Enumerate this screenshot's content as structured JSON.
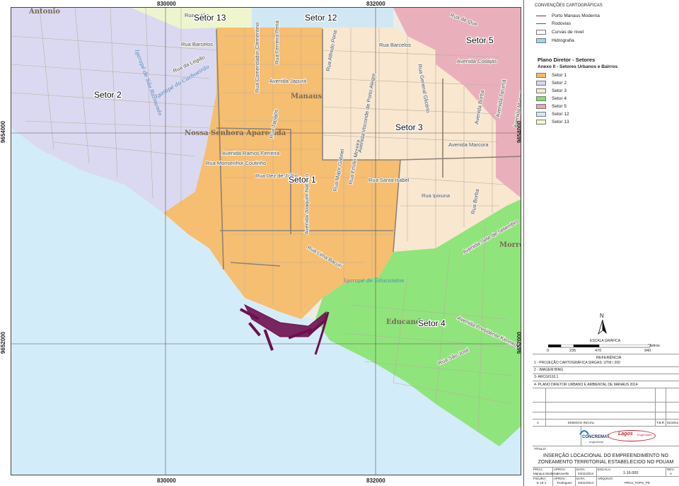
{
  "coordinates": {
    "top": [
      "830000",
      "832000"
    ],
    "bottom": [
      "830000",
      "832000"
    ],
    "left": [
      "9654000",
      "9652000"
    ],
    "right": [
      "9654000",
      "9652000"
    ]
  },
  "map": {
    "sectors": [
      {
        "label": "Setor 1",
        "color": "#f6b964"
      },
      {
        "label": "Setor 2",
        "color": "#d7d6f3"
      },
      {
        "label": "Setor 3",
        "color": "#f9e7cf"
      },
      {
        "label": "Setor 4",
        "color": "#7fe36a"
      },
      {
        "label": "Setor 5",
        "color": "#e8a6b4"
      },
      {
        "label": "Setor 12",
        "color": "#cfe8f4"
      },
      {
        "label": "Setor 13",
        "color": "#eef7cb"
      }
    ],
    "streets": [
      "Rua Avião",
      "Rua Barcelos",
      "Rua da Legião",
      "Rua Comendador Clementino",
      "Rua Ferreira Pena",
      "Avenida Japurá",
      "Rua Alfredo Pena",
      "Rua Tapajós",
      "Avenida Ramos Ferreira",
      "Rua Monsenhor Coutinho",
      "Rua Dez de Julho",
      "Rua Marechal Deodoro",
      "Avenida Joaquim Nabuco",
      "Rua Major Gabriel",
      "Rua Emílio Moreira",
      "Rua Santa Isabel",
      "Avenida Visconde de Porto Alegre",
      "Rua Lima Bacuri",
      "Rua Barcelos",
      "Avenida Codajás",
      "Rua General Glicério",
      "Avenida Marcora",
      "Avenida Borba",
      "Avenida Tarumã",
      "Avenida Manaus",
      "Rua Ipixuna",
      "Rua Borba",
      "Avenida Presidente Kennedy",
      "Rua Ceará",
      "Rua São José",
      "Avenida Sete de Setembro",
      "Rua Dr. Tapajós",
      "Rua de Que"
    ],
    "places": [
      "Antonio",
      "Nossa Senhora Aparecida",
      "Manaus",
      "Morro da Liberdade",
      "Educandos"
    ],
    "hydro": [
      "Igarapé de São Raimundo",
      "Igarapé do Cachoeirão",
      "Igarapé de Educandos"
    ],
    "port_color": "#6e0f4f"
  },
  "legend": {
    "heading": "CONVENÇÕES CARTOGRÁFICAS",
    "items": [
      {
        "label": "Porto Manaus Moderna",
        "kind": "line",
        "color": "#8e1f5b"
      },
      {
        "label": "Rodovias",
        "kind": "line",
        "color": "#555555"
      },
      {
        "label": "Curvas de nível",
        "kind": "box",
        "color": "#ffffff"
      },
      {
        "label": "Hidrografia",
        "kind": "box",
        "color": "#9fd4ef"
      }
    ],
    "plan_title": "Plano Diretor - Setores",
    "plan_subtitle": "Anexo II - Setores Urbanos e Bairros",
    "sector_items": [
      "Setor 1",
      "Setor 2",
      "Setor 3",
      "Setor 4",
      "Setor 5",
      "Setor 12",
      "Setor 13"
    ]
  },
  "north": {
    "letter": "N"
  },
  "scale": {
    "caption": "ESCALA GRÁFICA",
    "unit": "Metros",
    "ticks": [
      "0",
      "235",
      "470",
      "940"
    ]
  },
  "reference": {
    "title": "REFERÊNCIA",
    "items": [
      "1 - PROJEÇÃO CARTOGRÁFICA SIRGAS: UTM / 200",
      "2 - IMAGEM BING",
      "3- ARCGIS10.1",
      "4- PLANO DIRETOR URBANO E AMBIENTAL DE MANAUS 2014"
    ]
  },
  "revision": {
    "rev": "A",
    "text": "EMISSÃO INICIAL",
    "by": "T.B.R.",
    "date": "01/2014"
  },
  "logos": {
    "left": "CONCREMAT",
    "left_sub": "engenharia",
    "right": "Lagos",
    "right_sub": "Engenharia"
  },
  "title_block": {
    "label": "TÍTULO:",
    "title": "INSERÇÃO LOCACIONAL DO EMPREENDIMENTO NO ZONEAMENTO TERRITORIAL ESTABELECIDO NO PDUAM",
    "cells": {
      "proj_label": "PROJ.:",
      "proj": "Manaus Moderna",
      "aprov_label": "APROV.:",
      "aprov": "Anovello",
      "data_label": "DATA:",
      "data": "04/11/2014",
      "escala_label": "ESCALA:",
      "escala": "1:16.000",
      "rev_label": "REV.:",
      "rev": "A",
      "figura_label": "FIGURA:",
      "figura": "E.19-1",
      "aprov2_label": "APROV.:",
      "aprov2": "Trodrigues",
      "data2_label": "DATA:",
      "data2": "04/11/2014",
      "arquivo_label": "ARQUIVO:",
      "arquivo": "PROJ_TOPO_PD"
    }
  }
}
